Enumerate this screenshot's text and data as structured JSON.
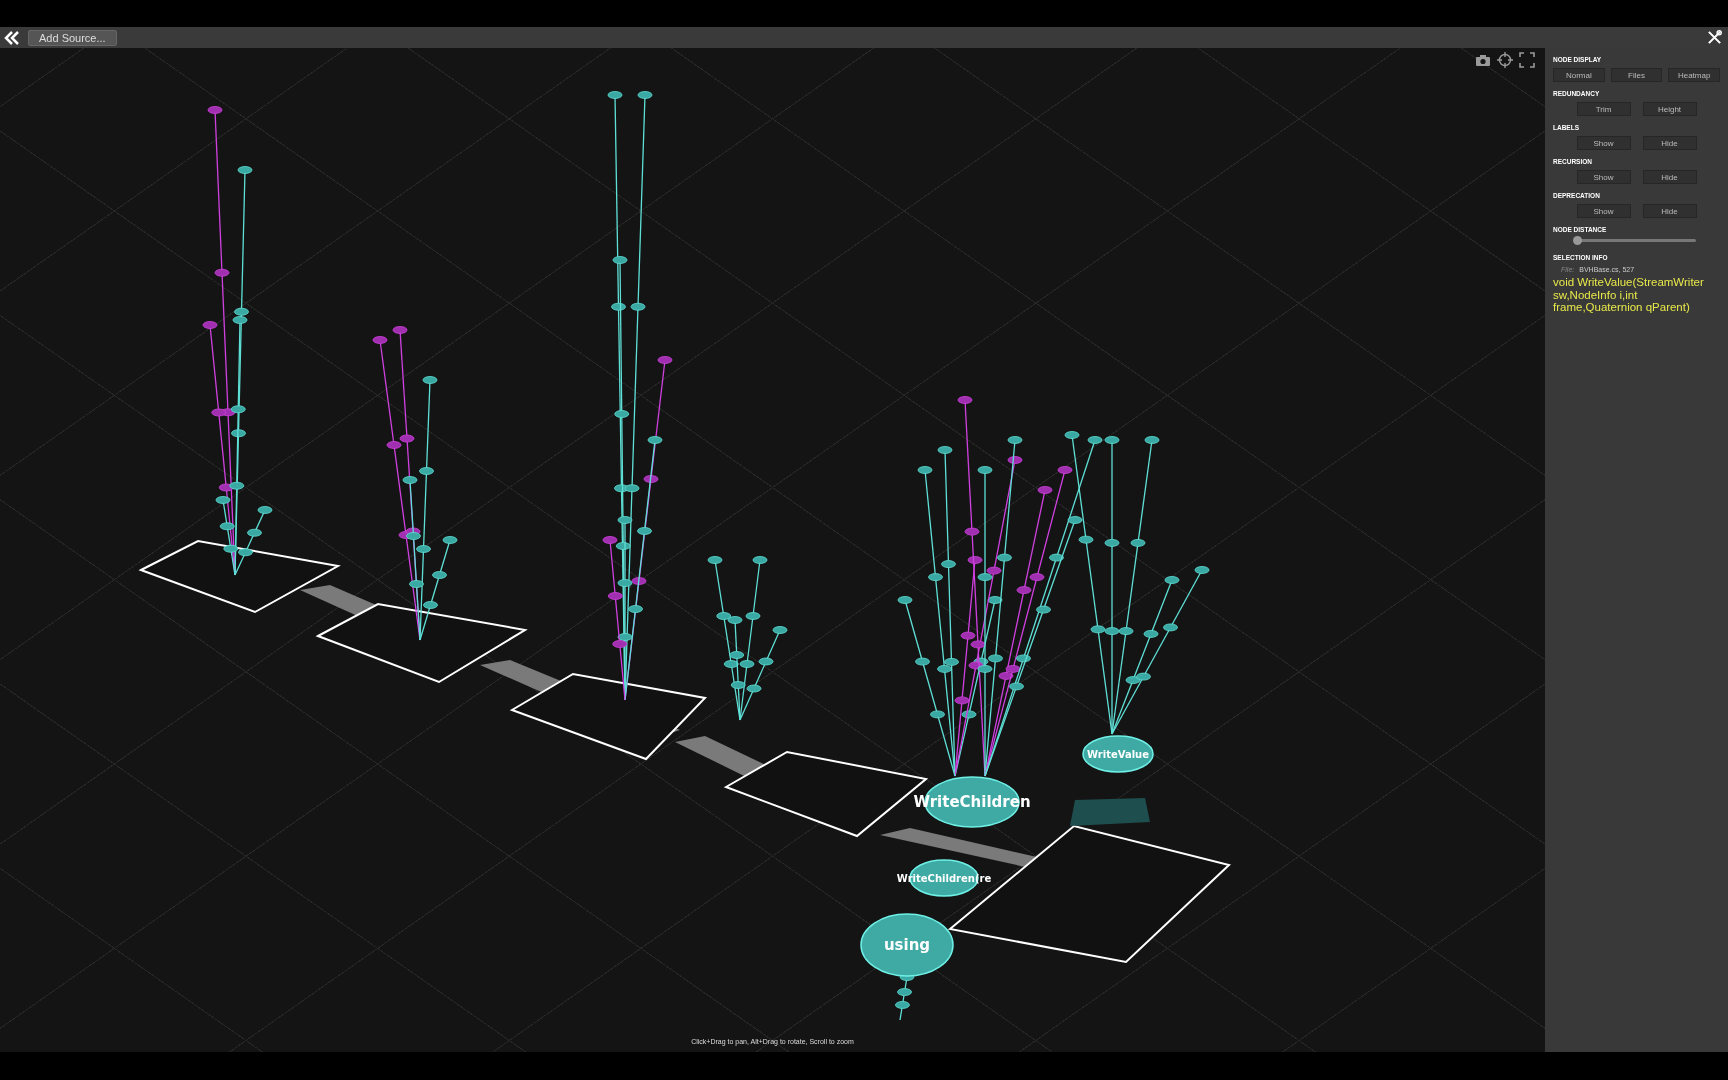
{
  "toolbar": {
    "add_source": "Add Source..."
  },
  "panel": {
    "sections": [
      {
        "title": "NODE DISPLAY",
        "buttons": [
          "Normal",
          "Files",
          "Heatmap"
        ]
      },
      {
        "title": "REDUNDANCY",
        "buttons": [
          "Trim",
          "Height"
        ]
      },
      {
        "title": "LABELS",
        "buttons": [
          "Show",
          "Hide"
        ]
      },
      {
        "title": "RECURSION",
        "buttons": [
          "Show",
          "Hide"
        ]
      },
      {
        "title": "DEPRECATION",
        "buttons": [
          "Show",
          "Hide"
        ]
      }
    ],
    "node_distance": {
      "label": "NODE DISTANCE",
      "level": 0
    },
    "selection_info": {
      "title": "SELECTION INFO",
      "file_label": "File:",
      "file_value": "BVHBase.cs, 527",
      "signature": "void WriteValue(StreamWriter sw,NodeInfo i,int frame,Quaternion qParent)"
    }
  },
  "graph": {
    "nodes": [
      {
        "label": "WriteChildren"
      },
      {
        "label": "WriteChildren(re"
      },
      {
        "label": "using"
      },
      {
        "label": "WriteValue"
      }
    ]
  },
  "hint": "Click+Drag to pan, Alt+Drag to rotate, Scroll to zoom"
}
